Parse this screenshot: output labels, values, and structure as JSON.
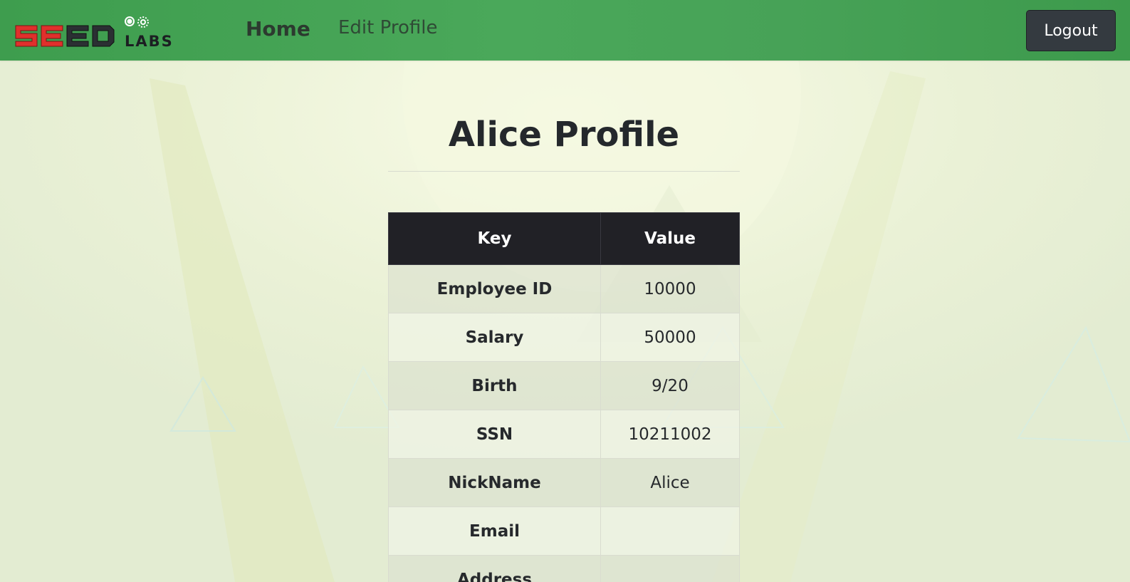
{
  "navbar": {
    "logo": {
      "text": "SEED LABS",
      "icon": "gears-icon"
    },
    "home_label": "Home",
    "edit_profile_label": "Edit Profile",
    "logout_label": "Logout"
  },
  "main": {
    "title": "Alice Profile",
    "table": {
      "headers": [
        "Key",
        "Value"
      ],
      "rows": [
        {
          "key": "Employee ID",
          "value": "10000"
        },
        {
          "key": "Salary",
          "value": "50000"
        },
        {
          "key": "Birth",
          "value": "9/20"
        },
        {
          "key": "SSN",
          "value": "10211002"
        },
        {
          "key": "NickName",
          "value": "Alice"
        },
        {
          "key": "Email",
          "value": ""
        },
        {
          "key": "Address",
          "value": ""
        }
      ]
    }
  },
  "colors": {
    "navbar": "#47a257",
    "logout_button": "#343a40",
    "table_header": "#212126",
    "logo_red": "#e0302c",
    "background": "#eef3df"
  }
}
